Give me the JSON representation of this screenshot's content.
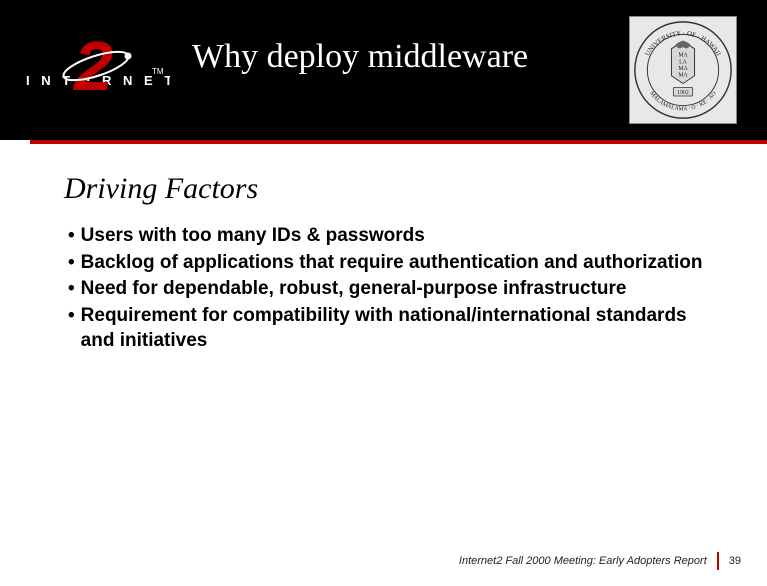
{
  "header": {
    "title": "Why deploy middleware",
    "logo_left": {
      "brand_top": "I N T E R N E T",
      "numeral": "2",
      "tm": "TM"
    },
    "seal": {
      "outer_top": "UNIVERSITY · OF · HAWAII",
      "inner_words": [
        "MA",
        "LA",
        "MA",
        "MA"
      ],
      "year": "1902",
      "outer_bottom": "MALAMALAMA · O · KE · AO"
    }
  },
  "content": {
    "subheading": "Driving Factors",
    "bullets": [
      "Users with too many IDs & passwords",
      "Backlog of applications that  require authentication and authorization",
      "Need for dependable, robust, general-purpose infrastructure",
      "Requirement for compatibility with national/international standards and initiatives"
    ]
  },
  "footer": {
    "text": "Internet2 Fall 2000 Meeting: Early Adopters Report",
    "page": "39"
  }
}
